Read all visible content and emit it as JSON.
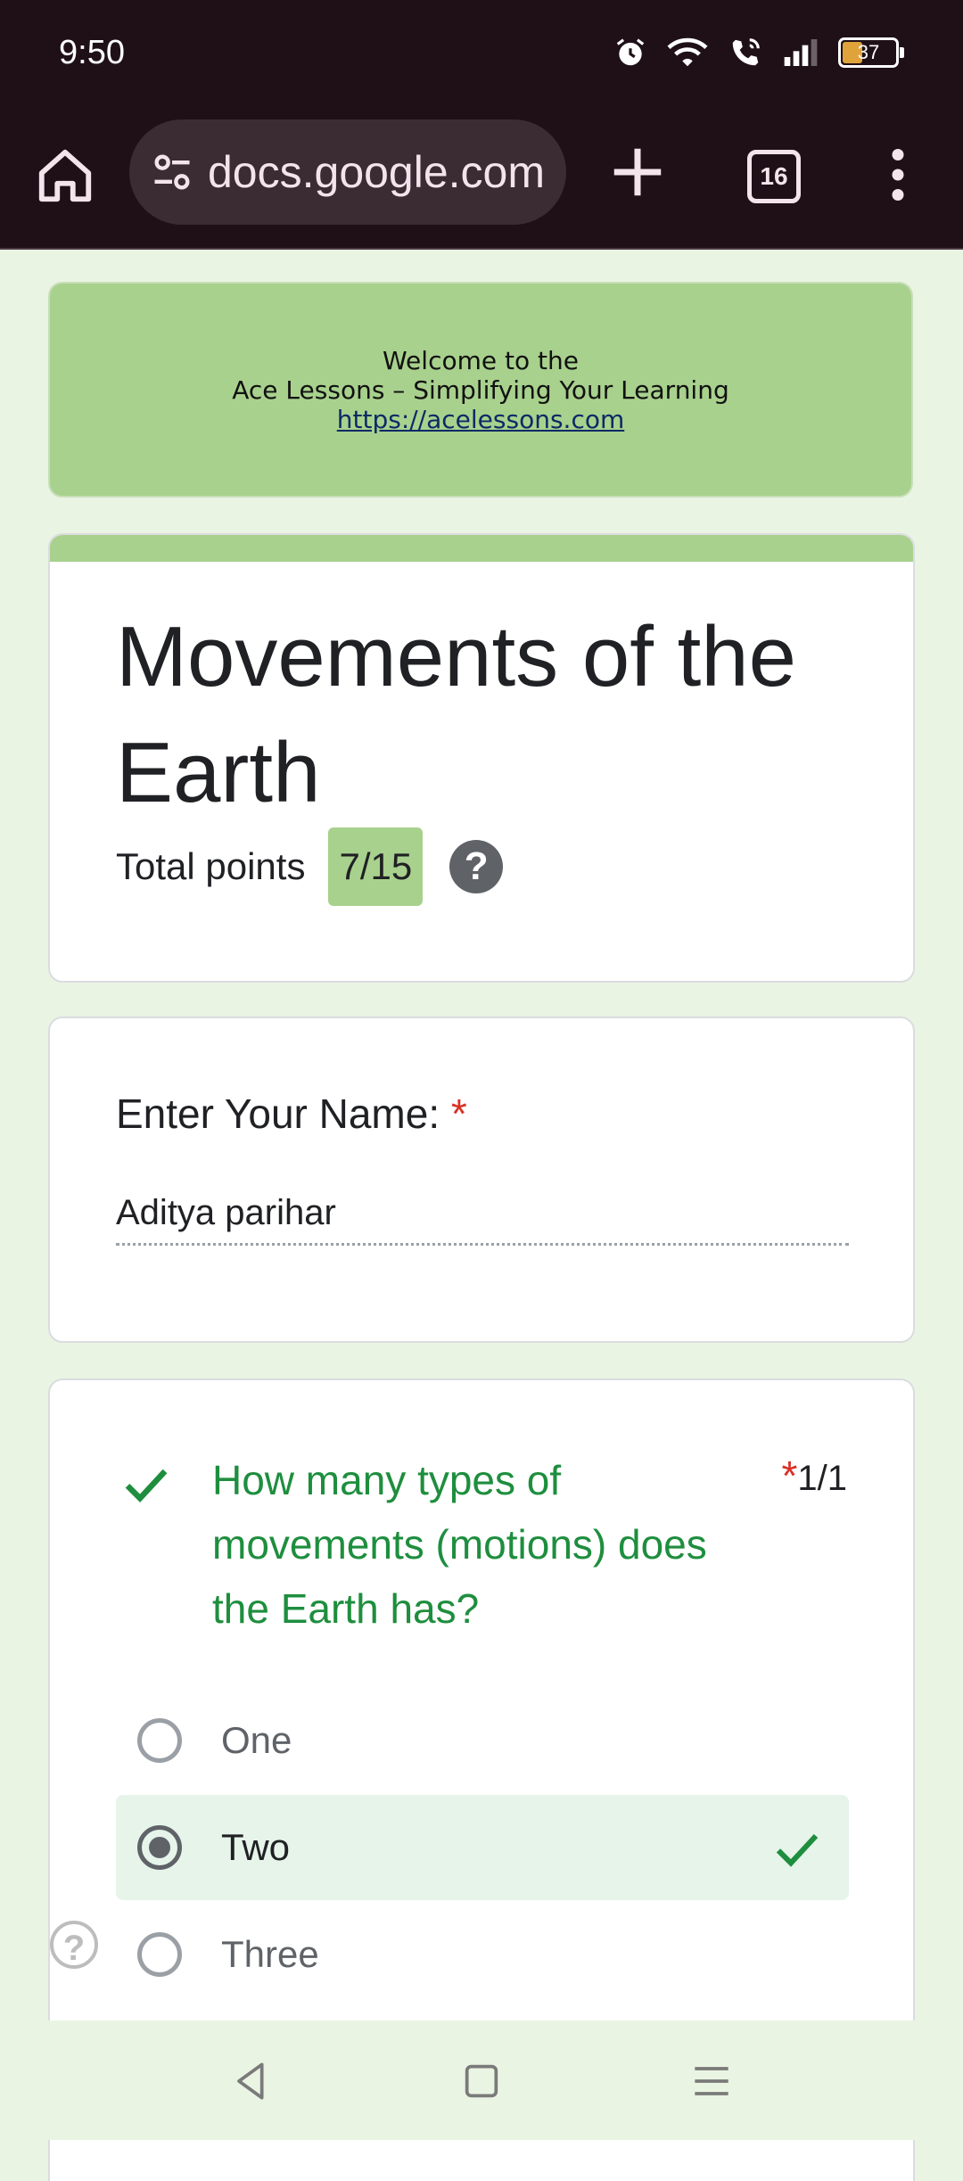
{
  "status_bar": {
    "time": "9:50",
    "battery_level": "37",
    "icons": [
      "alarm-icon",
      "wifi-icon",
      "wifi-calling-icon",
      "signal-icon",
      "battery-icon"
    ]
  },
  "browser": {
    "url": "docs.google.com",
    "tab_count": "16"
  },
  "banner": {
    "line1": "Welcome to the",
    "line2": "Ace Lessons – Simplifying Your Learning",
    "link": "https://acelessons.com",
    "color": "#a8d18d"
  },
  "form": {
    "title": "Movements of the Earth",
    "total_points_label": "Total points",
    "total_points_value": "7/15",
    "help_symbol": "?"
  },
  "name_question": {
    "label": "Enter Your Name:",
    "required_mark": "*",
    "answer": "Aditya parihar"
  },
  "question1": {
    "text": "How many types of movements (motions) does the Earth has?",
    "required_mark": "*",
    "score": "1/1",
    "status": "correct",
    "options": [
      {
        "label": "One",
        "selected": false
      },
      {
        "label": "Two",
        "selected": true,
        "correct": true
      },
      {
        "label": "Three",
        "selected": false
      }
    ]
  },
  "floating_help": "?",
  "colors": {
    "correct_green": "#1e8e3e",
    "required_red": "#d93025",
    "page_bg": "#eaf4e3",
    "browser_bar": "#1f1018"
  }
}
